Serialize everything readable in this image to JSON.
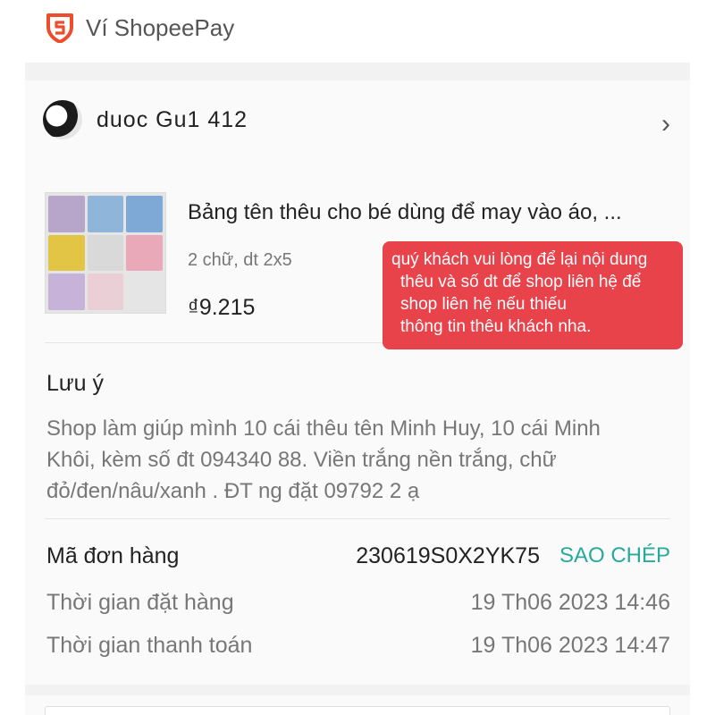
{
  "header": {
    "title": "Ví ShopeePay",
    "logo_icon": "shopeepay-shield-icon",
    "brand_color": "#ee4d2d"
  },
  "shop": {
    "name": "duoc Gu1 412",
    "chevron": "›"
  },
  "product": {
    "title": "Bảng tên thêu cho bé dùng để may vào áo, ...",
    "variant": "2 chữ, dt 2x5",
    "price": "₫9.215"
  },
  "overlay_note": {
    "lines": [
      "quý khách vui lòng để lại nội dung",
      "thêu và số dt để shop liên hệ để",
      "shop liên hệ nếu thiếu",
      "thông tin thêu khách nha."
    ],
    "color": "#e8424a"
  },
  "note": {
    "label": "Lưu ý",
    "lines": [
      "Shop làm giúp mình 10 cái thêu tên Minh Huy, 10 cái Minh",
      "Khôi, kèm số đt 094340 88. Viền trắng nền trắng, chữ",
      "đỏ/đen/nâu/xanh . ĐT ng đặt 09792 2 ạ"
    ]
  },
  "order": {
    "id_label": "Mã đơn hàng",
    "id_value": "230619S0X2YK75",
    "copy_label": "SAO CHÉP",
    "copy_color": "#26aa99",
    "order_time_label": "Thời gian đặt hàng",
    "order_time_value": "19 Th06 2023 14:46",
    "payment_time_label": "Thời gian thanh toán",
    "payment_time_value": "19 Th06 2023 14:47"
  }
}
